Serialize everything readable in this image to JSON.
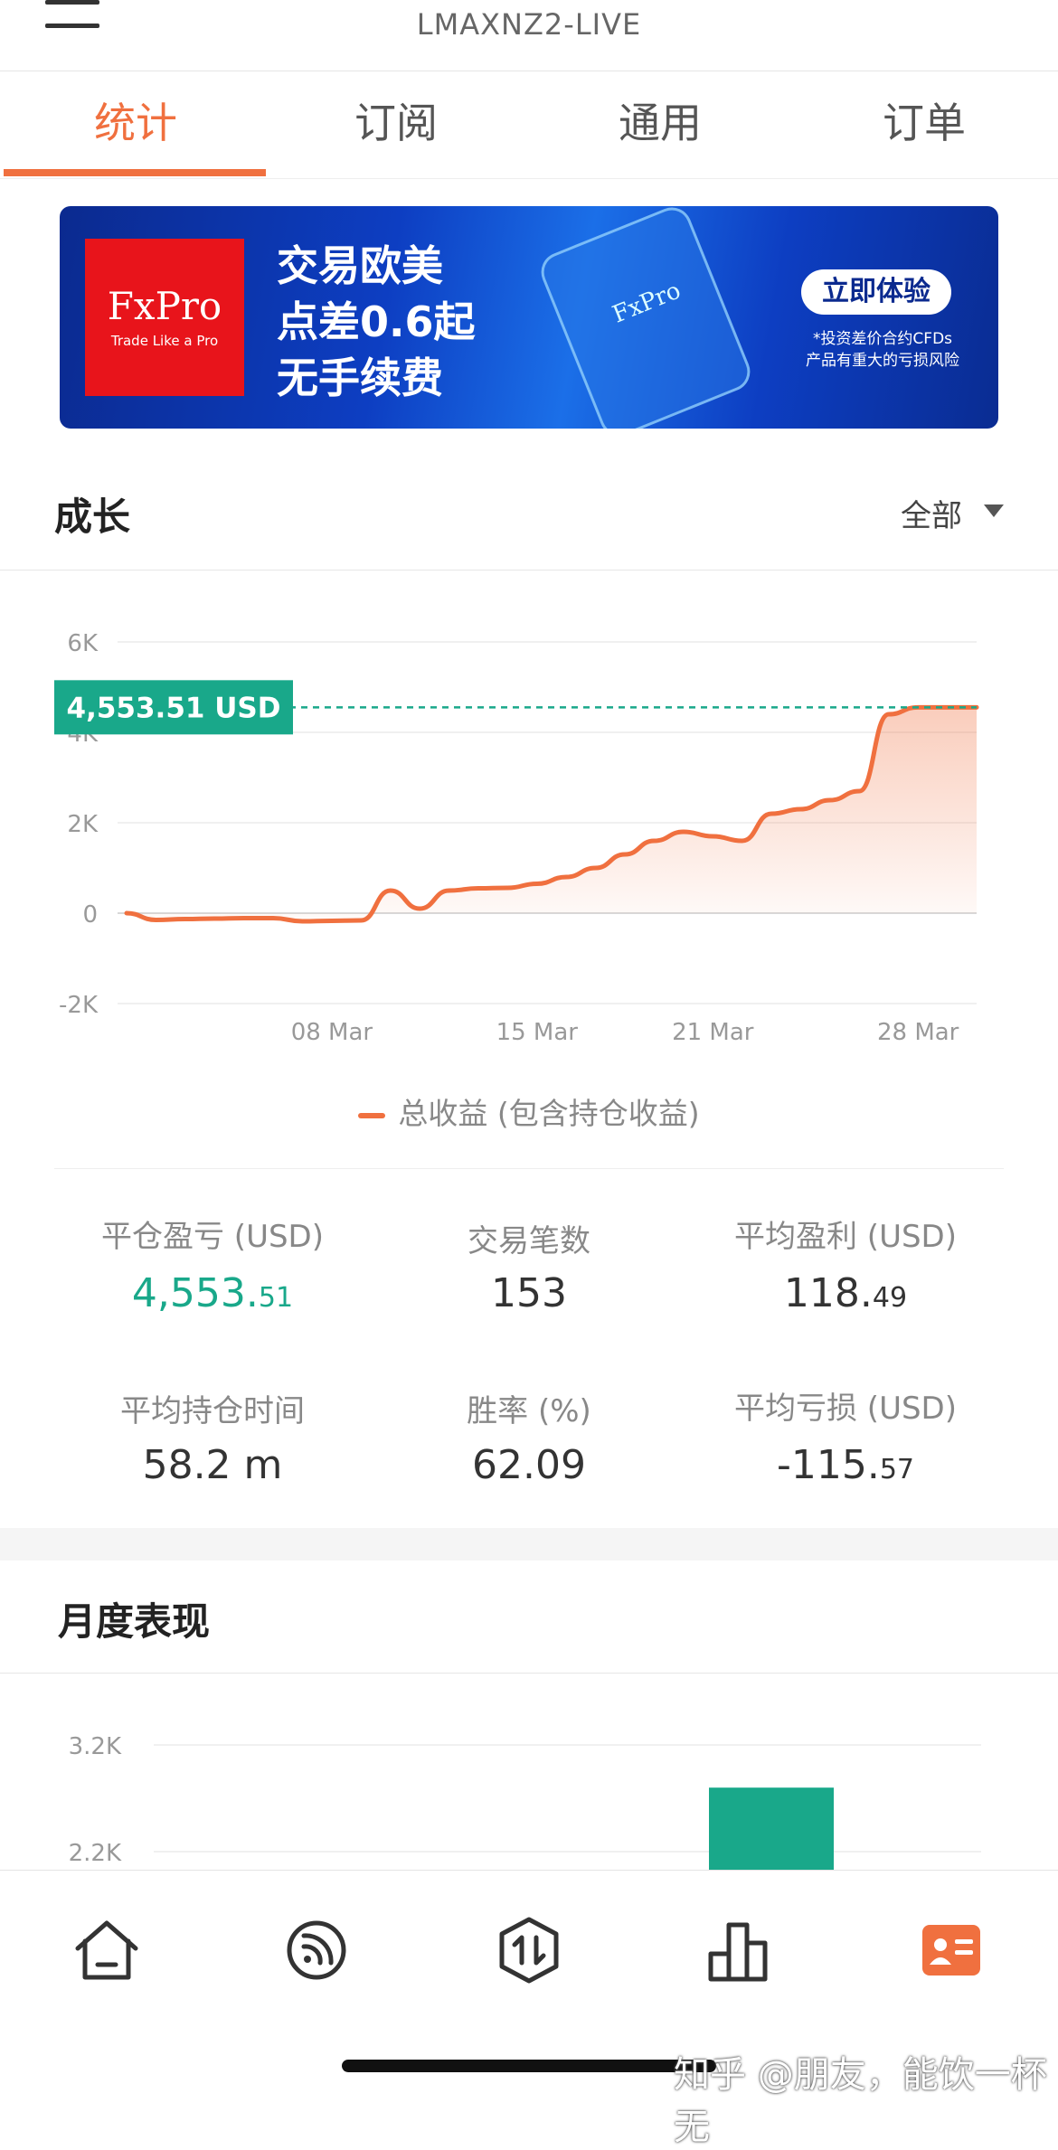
{
  "header": {
    "account": "LMAXNZ2-LIVE"
  },
  "tabs": [
    {
      "label": "统计",
      "active": true
    },
    {
      "label": "订阅",
      "active": false
    },
    {
      "label": "通用",
      "active": false
    },
    {
      "label": "订单",
      "active": false
    }
  ],
  "banner": {
    "logo_text": "FxPro",
    "logo_tagline": "Trade Like a Pro",
    "line1": "交易欧美",
    "line2": "点差0.6起",
    "line3": "无手续费",
    "phone_logo": "FxPro",
    "cta": "立即体验",
    "note1": "*投资差价合约CFDs",
    "note2": "产品有重大的亏损风险"
  },
  "growth": {
    "title": "成长",
    "filter": "全部",
    "current_label": "4,553.51 USD",
    "legend": "总收益 (包含持仓收益)"
  },
  "stats": {
    "closed_pl": {
      "label": "平仓盈亏 (USD)",
      "int": "4,553.",
      "dec": "51"
    },
    "trades": {
      "label": "交易笔数",
      "value": "153"
    },
    "avg_profit": {
      "label": "平均盈利 (USD)",
      "int": "118.",
      "dec": "49"
    },
    "avg_hold": {
      "label": "平均持仓时间",
      "value": "58.2 m"
    },
    "win_rate": {
      "label": "胜率 (%)",
      "value": "62.09"
    },
    "avg_loss": {
      "label": "平均亏损 (USD)",
      "int": "-115.",
      "dec": "57"
    }
  },
  "monthly": {
    "title": "月度表现"
  },
  "nav": [
    {
      "name": "home",
      "icon": "home-icon"
    },
    {
      "name": "signals",
      "icon": "broadcast-icon"
    },
    {
      "name": "trade",
      "icon": "trade-arrows-icon"
    },
    {
      "name": "stats",
      "icon": "bar-chart-icon"
    },
    {
      "name": "profile",
      "icon": "profile-card-icon",
      "active": true
    }
  ],
  "watermark": "知乎 @朋友，能饮一杯无",
  "colors": {
    "accent": "#f0703f",
    "green": "#19a88a",
    "banner_blue": "#0d3ec2",
    "fxpro_red": "#e8141b"
  },
  "chart_data": [
    {
      "type": "area",
      "series": [
        {
          "name": "总收益 (包含持仓收益)",
          "x": [
            "Mar 01",
            "Mar 02",
            "Mar 03",
            "Mar 04",
            "Mar 05",
            "Mar 06",
            "Mar 07",
            "Mar 08",
            "Mar 09",
            "Mar 10",
            "Mar 11",
            "Mar 12",
            "Mar 13",
            "Mar 14",
            "Mar 15",
            "Mar 16",
            "Mar 17",
            "Mar 18",
            "Mar 19",
            "Mar 20",
            "Mar 21",
            "Mar 22",
            "Mar 23",
            "Mar 24",
            "Mar 25",
            "Mar 26",
            "Mar 27",
            "Mar 28",
            "Mar 29",
            "Mar 30"
          ],
          "values": [
            0,
            -150,
            -130,
            -120,
            -110,
            -110,
            -180,
            -170,
            -160,
            500,
            100,
            500,
            550,
            560,
            650,
            800,
            1000,
            1300,
            1600,
            1800,
            1700,
            1600,
            2200,
            2300,
            2500,
            2700,
            4400,
            4553.51,
            4553.51,
            4553.51
          ]
        }
      ],
      "xticks": [
        "08 Mar",
        "15 Mar",
        "21 Mar",
        "28 Mar"
      ],
      "yticks": [
        "-2K",
        "0",
        "2K",
        "4K",
        "6K"
      ],
      "ylim": [
        -2000,
        6000
      ],
      "current_value": 4553.51,
      "grid": true
    },
    {
      "type": "bar",
      "yticks": [
        "2.2K",
        "3.2K"
      ],
      "ylim": [
        2200,
        3200
      ],
      "values": [
        2800
      ]
    }
  ]
}
